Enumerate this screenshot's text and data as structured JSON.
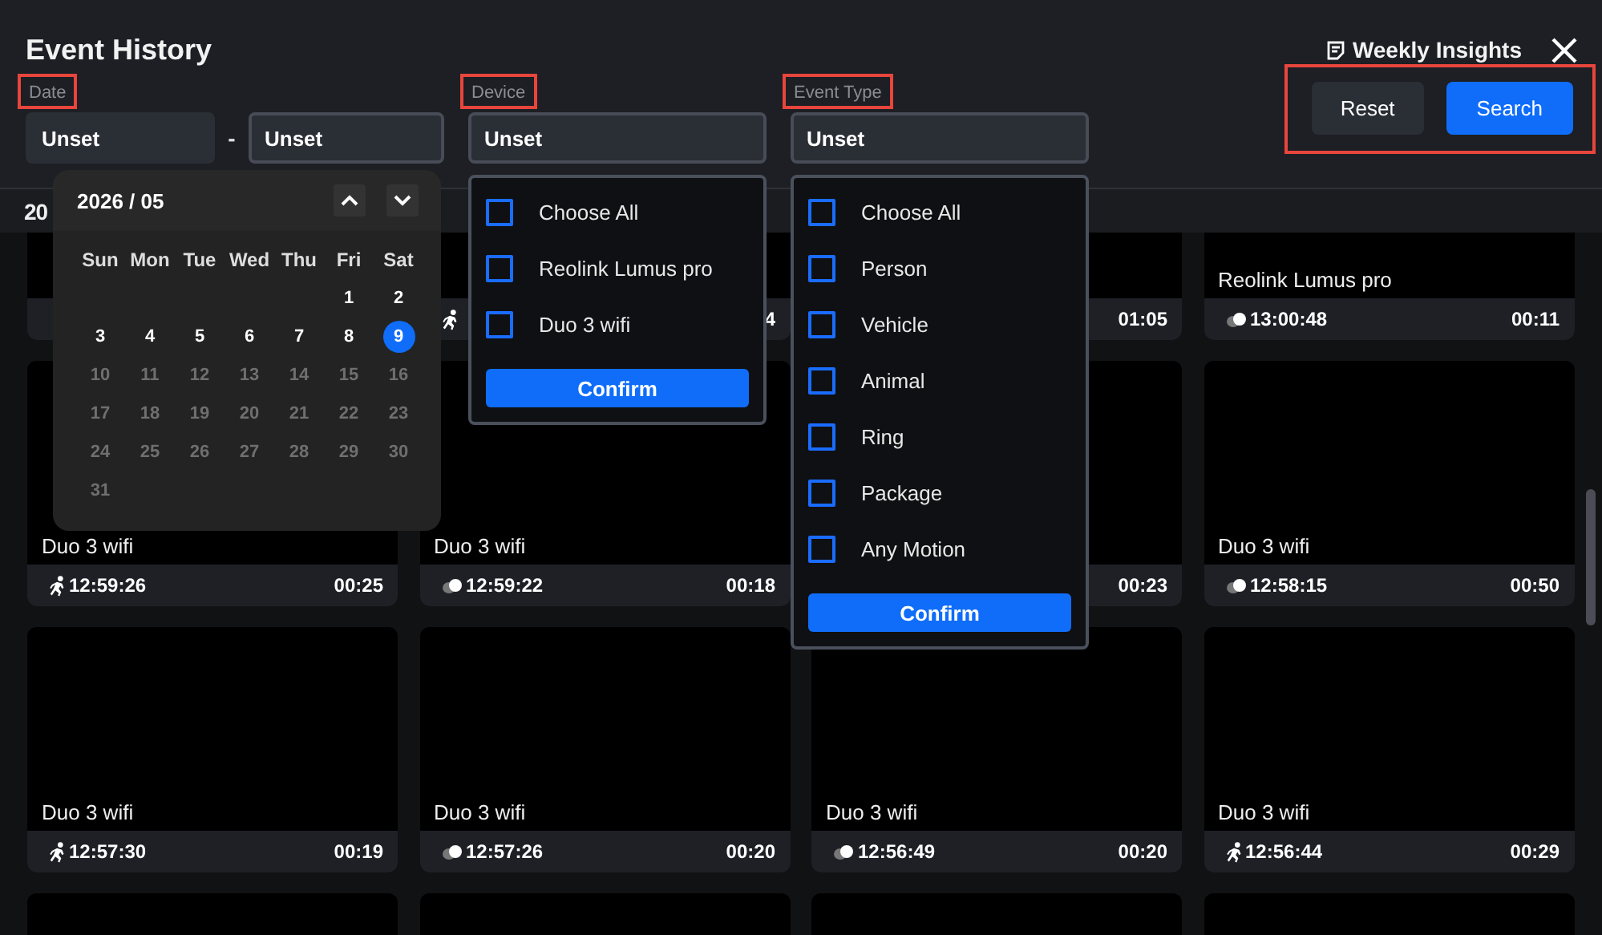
{
  "window": {
    "title": "Event History",
    "insights": "Weekly Insights"
  },
  "filters": {
    "date": {
      "label": "Date",
      "highlighted": true,
      "from": "Unset",
      "separator": "-",
      "to": "Unset"
    },
    "device": {
      "label": "Device",
      "highlighted": true,
      "value": "Unset"
    },
    "event_type": {
      "label": "Event Type",
      "highlighted": true,
      "value": "Unset"
    }
  },
  "actions": {
    "highlighted": true,
    "buttons": [
      {
        "label": "Reset",
        "kind": "secondary"
      },
      {
        "label": "Search",
        "kind": "primary"
      }
    ]
  },
  "date_heading": "20",
  "calendar": {
    "title": "2026 / 05",
    "weekdays": [
      "Sun",
      "Mon",
      "Tue",
      "Wed",
      "Thu",
      "Fri",
      "Sat"
    ],
    "days": [
      {
        "label": "1",
        "disabled": false,
        "selected": false
      },
      {
        "label": "2",
        "disabled": false,
        "selected": false
      },
      {
        "label": "3",
        "disabled": false,
        "selected": false
      },
      {
        "label": "4",
        "disabled": false,
        "selected": false
      },
      {
        "label": "5",
        "disabled": false,
        "selected": false
      },
      {
        "label": "6",
        "disabled": false,
        "selected": false
      },
      {
        "label": "7",
        "disabled": false,
        "selected": false
      },
      {
        "label": "8",
        "disabled": false,
        "selected": false
      },
      {
        "label": "9",
        "disabled": false,
        "selected": true
      },
      {
        "label": "10",
        "disabled": true,
        "selected": false
      },
      {
        "label": "11",
        "disabled": true,
        "selected": false
      },
      {
        "label": "12",
        "disabled": true,
        "selected": false
      },
      {
        "label": "13",
        "disabled": true,
        "selected": false
      },
      {
        "label": "14",
        "disabled": true,
        "selected": false
      },
      {
        "label": "15",
        "disabled": true,
        "selected": false
      },
      {
        "label": "16",
        "disabled": true,
        "selected": false
      },
      {
        "label": "17",
        "disabled": true,
        "selected": false
      },
      {
        "label": "18",
        "disabled": true,
        "selected": false
      },
      {
        "label": "19",
        "disabled": true,
        "selected": false
      },
      {
        "label": "20",
        "disabled": true,
        "selected": false
      },
      {
        "label": "21",
        "disabled": true,
        "selected": false
      },
      {
        "label": "22",
        "disabled": true,
        "selected": false
      },
      {
        "label": "23",
        "disabled": true,
        "selected": false
      },
      {
        "label": "24",
        "disabled": true,
        "selected": false
      },
      {
        "label": "25",
        "disabled": true,
        "selected": false
      },
      {
        "label": "26",
        "disabled": true,
        "selected": false
      },
      {
        "label": "27",
        "disabled": true,
        "selected": false
      },
      {
        "label": "28",
        "disabled": true,
        "selected": false
      },
      {
        "label": "29",
        "disabled": true,
        "selected": false
      },
      {
        "label": "30",
        "disabled": true,
        "selected": false
      },
      {
        "label": "31",
        "disabled": true,
        "selected": false
      }
    ]
  },
  "device_menu": {
    "options": [
      {
        "label": "Choose All",
        "checked": false
      },
      {
        "label": "Reolink Lumus pro",
        "checked": false
      },
      {
        "label": "Duo 3 wifi",
        "checked": false
      }
    ],
    "confirm": "Confirm"
  },
  "event_menu": {
    "options": [
      {
        "label": "Choose All",
        "checked": false
      },
      {
        "label": "Person",
        "checked": false
      },
      {
        "label": "Vehicle",
        "checked": false
      },
      {
        "label": "Animal",
        "checked": false
      },
      {
        "label": "Ring",
        "checked": false
      },
      {
        "label": "Package",
        "checked": false
      },
      {
        "label": "Any Motion",
        "checked": false
      }
    ],
    "confirm": "Confirm"
  },
  "events": [
    {
      "kind": "blank"
    },
    {
      "kind": "person",
      "duration": "4"
    },
    {
      "kind": "blank",
      "duration": "01:05"
    },
    {
      "name": "Reolink Lumus pro",
      "kind": "motion",
      "time": "13:00:48",
      "duration": "00:11"
    },
    {
      "name": "Duo 3 wifi",
      "kind": "person",
      "time": "12:59:26",
      "duration": "00:25"
    },
    {
      "name": "Duo 3 wifi",
      "kind": "motion",
      "time": "12:59:22",
      "duration": "00:18"
    },
    {
      "kind": "blank",
      "duration": "00:23"
    },
    {
      "name": "Duo 3 wifi",
      "kind": "motion",
      "time": "12:58:15",
      "duration": "00:50"
    },
    {
      "name": "Duo 3 wifi",
      "kind": "person",
      "time": "12:57:30",
      "duration": "00:19"
    },
    {
      "name": "Duo 3 wifi",
      "kind": "motion",
      "time": "12:57:26",
      "duration": "00:20"
    },
    {
      "name": "Duo 3 wifi",
      "kind": "motion",
      "time": "12:56:49",
      "duration": "00:20"
    },
    {
      "name": "Duo 3 wifi",
      "kind": "person",
      "time": "12:56:44",
      "duration": "00:29"
    },
    {
      "kind": "blank"
    },
    {
      "kind": "blank"
    },
    {
      "kind": "blank"
    },
    {
      "kind": "blank"
    }
  ]
}
